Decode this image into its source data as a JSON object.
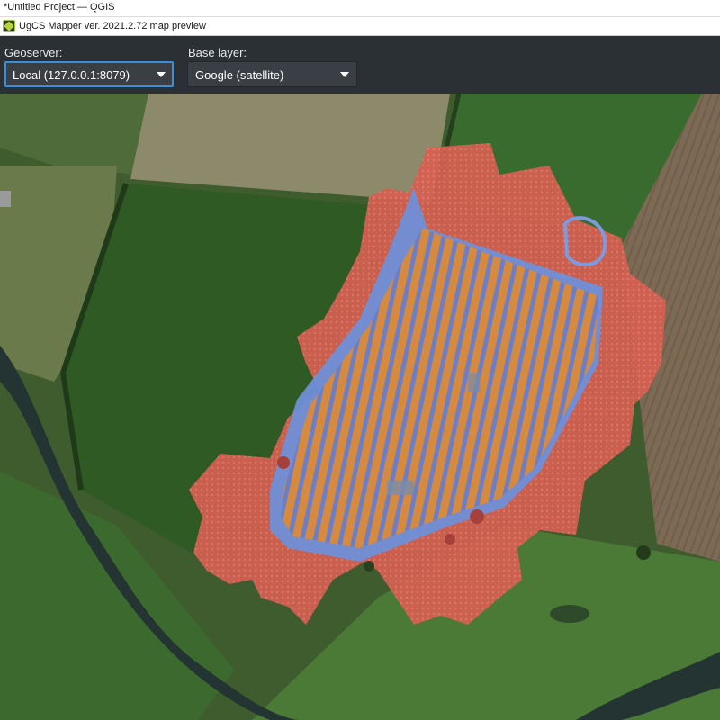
{
  "window": {
    "title": "*Untitled Project — QGIS"
  },
  "app": {
    "title": "UgCS Mapper ver. 2021.2.72 map preview",
    "icon": "ugcs-mapper-icon"
  },
  "toolbar": {
    "geoserver": {
      "label": "Geoserver:",
      "value": "Local (127.0.0.1:8079)"
    },
    "base_layer": {
      "label": "Base layer:",
      "value": "Google (satellite)"
    }
  },
  "colors": {
    "toolbar_bg": "#2b3035",
    "focus_border": "#3c8fd6",
    "overlay_red": "#d9574a",
    "overlay_blue": "#6f8fd8",
    "overlay_orange": "#d9893a"
  }
}
